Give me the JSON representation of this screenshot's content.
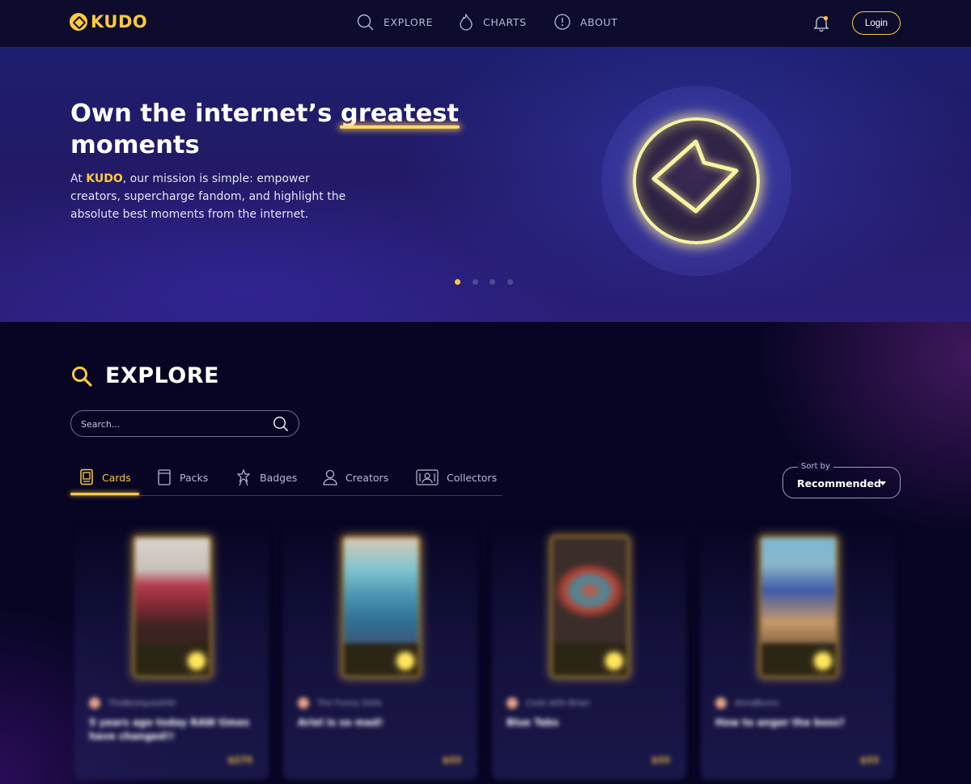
{
  "brand": {
    "name": "KUDO",
    "accent": "#ffc93f",
    "background": "#070523"
  },
  "nav": {
    "items": [
      {
        "label": "EXPLORE",
        "icon": "search-icon"
      },
      {
        "label": "CHARTS",
        "icon": "flame-icon"
      },
      {
        "label": "ABOUT",
        "icon": "info-icon"
      }
    ],
    "login_label": "Login",
    "notification_icon": "bell-icon"
  },
  "hero": {
    "title_pre": "Own the internet’s ",
    "title_highlight": "greatest",
    "title_post": " moments",
    "desc_pre": "At ",
    "desc_brand": "KUDO",
    "desc_post": ", our mission is simple: empower creators, supercharge fandom, and highlight the absolute best moments from the internet.",
    "slides_total": 4,
    "active_slide": 1
  },
  "explore": {
    "heading": "EXPLORE",
    "search_placeholder": "Search...",
    "tabs": [
      {
        "label": "Cards",
        "icon": "card-icon",
        "active": true
      },
      {
        "label": "Packs",
        "icon": "pack-icon",
        "active": false
      },
      {
        "label": "Badges",
        "icon": "badge-icon",
        "active": false
      },
      {
        "label": "Creators",
        "icon": "user-icon",
        "active": false
      },
      {
        "label": "Collectors",
        "icon": "collectors-icon",
        "active": false
      }
    ],
    "sort": {
      "label": "Sort by",
      "value": "Recommended"
    }
  },
  "cards": [
    {
      "creator": "TheBestquestHd",
      "title": "5 years ago today RAW times have changed!!",
      "price": "$275"
    },
    {
      "creator": "The Funny Dolls",
      "title": "Ariel is so mad!",
      "price": "$33"
    },
    {
      "creator": "Cook with Brian",
      "title": "Blue Tabs",
      "price": "$33"
    },
    {
      "creator": "AnnaBurns",
      "title": "How to anger the boss?",
      "price": "$33"
    }
  ]
}
